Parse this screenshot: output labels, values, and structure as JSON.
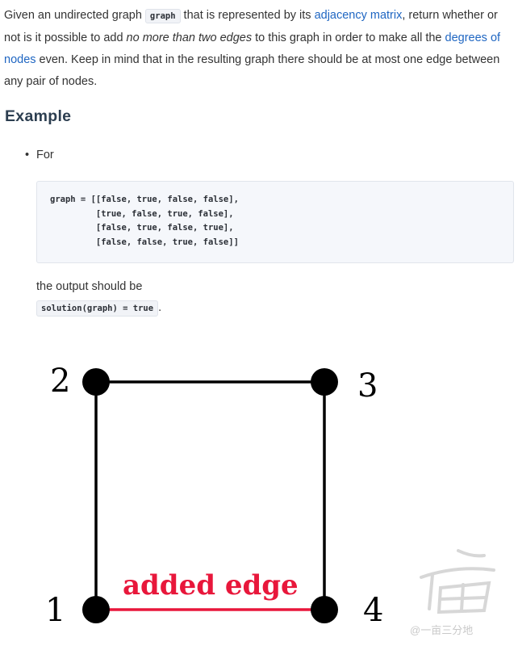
{
  "description": {
    "p1": "Given an undirected graph ",
    "graph_code": "graph",
    "p2": " that is represented by its ",
    "link_adjacency": "adjacency matrix",
    "p3": ", return whether or not is it possible to add ",
    "emphasis": "no more than two edges",
    "p4": " to this graph in order to make all the ",
    "link_degrees": "degrees of nodes",
    "p5": " even. Keep in mind that in the resulting graph there should be at most one edge between any pair of nodes."
  },
  "example": {
    "heading": "Example",
    "bullet_label": "For",
    "code": "graph = [[false, true, false, false],\n         [true, false, true, false],\n         [false, true, false, true],\n         [false, false, true, false]]",
    "output_text": "the output should be",
    "output_code": "solution(graph) = true",
    "output_trailing": "."
  },
  "diagram": {
    "node_labels": [
      "2",
      "3",
      "1",
      "4"
    ],
    "added_edge_label": "added edge",
    "edge_color": "#000000",
    "added_edge_color": "#e8173b"
  },
  "watermark": {
    "text": "@一亩三分地"
  }
}
